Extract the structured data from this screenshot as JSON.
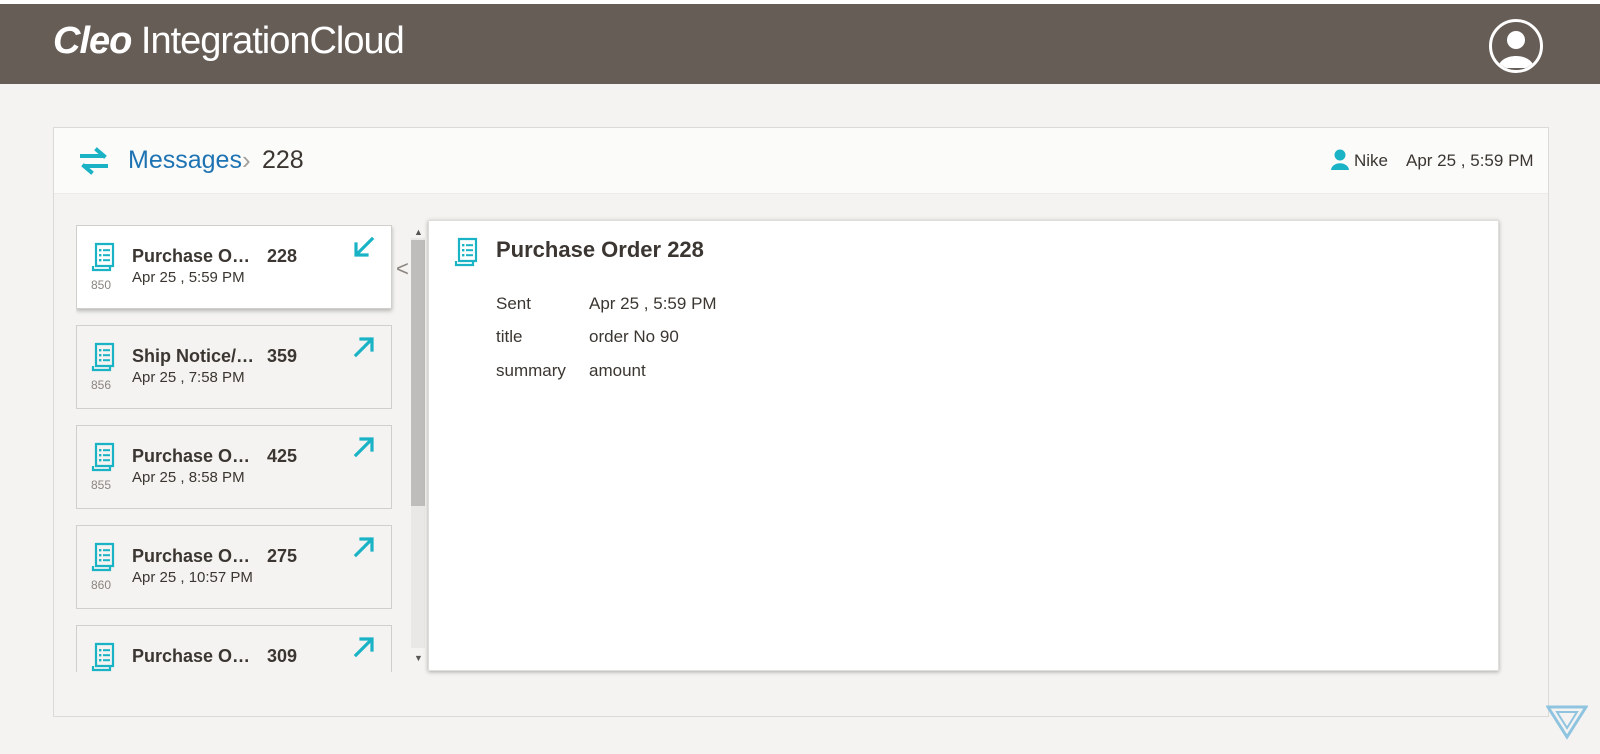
{
  "app": {
    "logo_bold": "Cleo",
    "logo_rest": " IntegrationCloud"
  },
  "breadcrumb": {
    "root": "Messages",
    "separator": "›",
    "current": "228"
  },
  "header_meta": {
    "user": "Nike",
    "time": "Apr 25 , 5:59 PM"
  },
  "messages": [
    {
      "title": "Purchase Order",
      "number": "228",
      "date": "Apr 25 , 5:59 PM",
      "code": "850",
      "direction": "inbound",
      "selected": true
    },
    {
      "title": "Ship Notice/Manifest",
      "number": "359",
      "date": "Apr 25 , 7:58 PM",
      "code": "856",
      "direction": "outbound",
      "selected": false
    },
    {
      "title": "Purchase Order",
      "number": "425",
      "date": "Apr 25 , 8:58 PM",
      "code": "855",
      "direction": "outbound",
      "selected": false
    },
    {
      "title": "Purchase Order",
      "number": "275",
      "date": "Apr 25 , 10:57 PM",
      "code": "860",
      "direction": "outbound",
      "selected": false
    },
    {
      "title": "Purchase Order",
      "number": "309",
      "date": "",
      "code": "",
      "direction": "outbound",
      "selected": false
    }
  ],
  "detail": {
    "title": "Purchase Order 228",
    "fields": [
      {
        "label": "Sent",
        "value": "Apr 25 , 5:59 PM"
      },
      {
        "label": "title",
        "value": "order No 90"
      },
      {
        "label": "summary",
        "value": "amount"
      }
    ]
  },
  "colors": {
    "header_bg": "#665d57",
    "accent_teal": "#1ab3c6",
    "link_blue": "#1e73b3",
    "text": "#3b3631"
  },
  "icons": {
    "user": "user-circle-icon",
    "swap": "swap-arrows-icon",
    "document": "document-list-icon",
    "inbound": "arrow-down-left-icon",
    "outbound": "arrow-up-right-icon"
  }
}
